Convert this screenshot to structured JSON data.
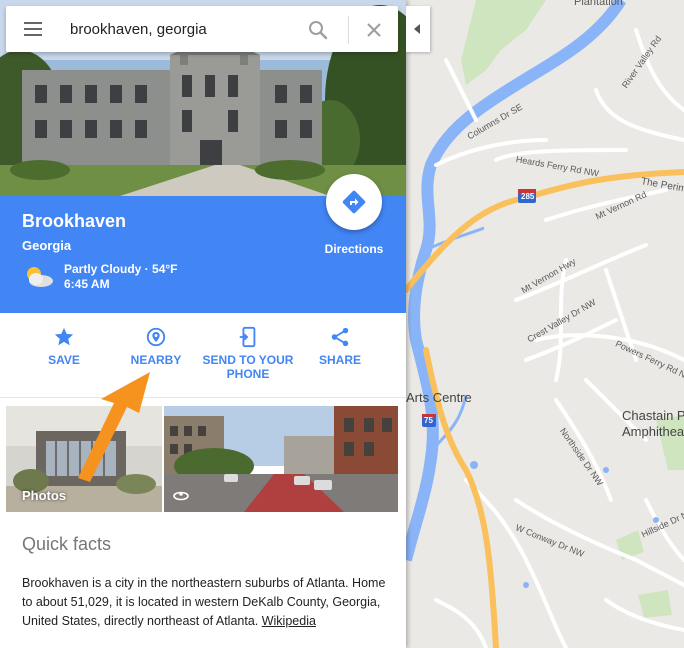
{
  "search": {
    "value": "brookhaven, georgia",
    "menu_icon": "hamburger-menu-icon",
    "search_icon": "search-icon",
    "clear_icon": "close-icon"
  },
  "place": {
    "name": "Brookhaven",
    "region": "Georgia",
    "weather_line1": "Partly Cloudy · 54°F",
    "weather_line2": "6:45 AM",
    "weather_icon": "partly-cloudy-icon"
  },
  "directions": {
    "label": "Directions",
    "icon": "directions-icon"
  },
  "actions": [
    {
      "label": "SAVE",
      "icon": "star-icon"
    },
    {
      "label": "NEARBY",
      "icon": "location-pin-icon"
    },
    {
      "label_line1": "SEND TO YOUR",
      "label_line2": "PHONE",
      "icon": "send-to-phone-icon"
    },
    {
      "label": "SHARE",
      "icon": "share-icon"
    }
  ],
  "photos": {
    "caption": "Photos",
    "streetview_icon": "street-view-icon"
  },
  "quick_facts": {
    "title": "Quick facts",
    "text": "Brookhaven is a city in the northeastern suburbs of Atlanta. Home to about 51,029, it is located in western DeKalb County, Georgia, United States, directly northeast of Atlanta.",
    "link": "Wikipedia"
  },
  "map": {
    "labels": [
      "Plantation",
      "River Valley Rd",
      "Columns Dr SE",
      "Heards Ferry Rd NW",
      "The Perim",
      "Mt Vernon Rd",
      "Mt Vernon Hwy",
      "Powers Ferry Rd NW",
      "Crest Valley Dr NW",
      "Arts Centre",
      "Chastain P",
      "Amphitheat",
      "Northside Dr NW",
      "Hillside Dr NW",
      "W Conway Dr NW"
    ],
    "shields": [
      "285",
      "75"
    ]
  },
  "colors": {
    "accent": "#4285f4",
    "arrow": "#f6921e",
    "river": "#8ab4f8",
    "highway": "#f9c05c"
  }
}
